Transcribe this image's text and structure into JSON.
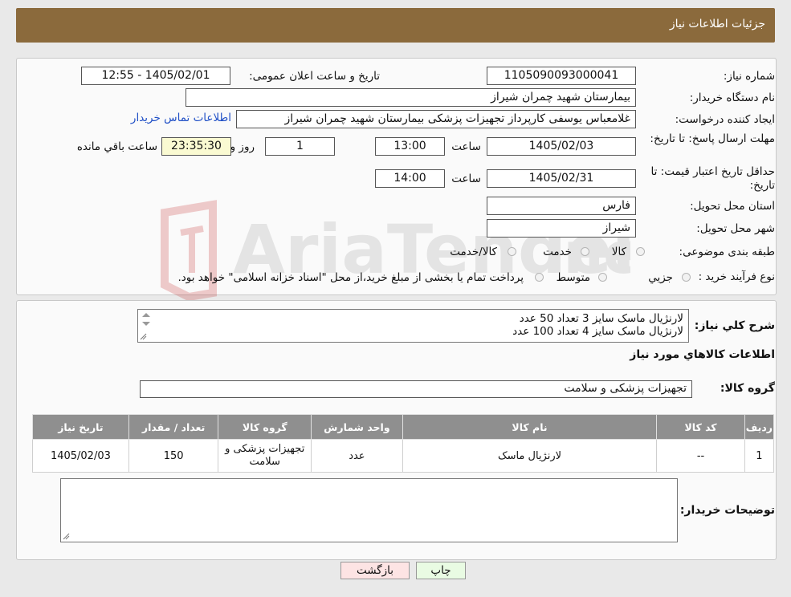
{
  "header": {
    "title": "جزئیات اطلاعات نیاز"
  },
  "fields": {
    "need_number_label": "شماره نیاز:",
    "need_number": "1105090093000041",
    "announce_label": "تاریخ و ساعت اعلان عمومی:",
    "announce_value": "1405/02/01 - 12:55",
    "buyer_org_label": "نام دستگاه خریدار:",
    "buyer_org": "بیمارستان شهید چمران شیراز",
    "requester_label": "ایجاد کننده درخواست:",
    "requester": "غلامعباس  یوسفی کارپرداز تجهیزات پزشکی بیمارستان شهید چمران شیراز",
    "contact_link": "اطلاعات تماس خریدار",
    "deadline_label": "مهلت ارسال پاسخ: تا تاریخ:",
    "deadline_date": "1405/02/03",
    "time_label": "ساعت",
    "deadline_time": "13:00",
    "days_value": "1",
    "days_label": "روز و",
    "remaining_value": "23:35:30",
    "remaining_label": "ساعت باقي مانده",
    "validity_label": "حداقل تاریخ اعتبار قیمت: تا تاریخ:",
    "validity_date": "1405/02/31",
    "validity_time_label": "ساعت",
    "validity_time": "14:00",
    "province_label": "استان محل تحویل:",
    "province": "فارس",
    "city_label": "شهر محل تحویل:",
    "city": "شیراز",
    "category_label": "طبقه بندی موضوعی:",
    "category_options": [
      "کالا",
      "خدمت",
      "کالا/خدمت"
    ],
    "process_label": "نوع فرآیند خرید :",
    "process_options": [
      "جزیي",
      "متوسط"
    ],
    "process_note": "پرداخت تمام یا بخشی از مبلغ خرید،از محل \"اسناد خزانه اسلامی\" خواهد بود."
  },
  "description": {
    "label": "شرح کلي نیاز:",
    "lines": [
      "لارنژیال ماسک سایز 3  تعداد 50 عدد",
      "لارنژیال ماسک سایز 4 تعداد 100 عدد"
    ]
  },
  "goods": {
    "section_title": "اطلاعات کالاهاي مورد نیاز",
    "group_label": "گروه کالا:",
    "group_value": "تجهیزات پزشکی و سلامت",
    "columns": [
      "ردیف",
      "کد کالا",
      "نام کالا",
      "واحد شمارش",
      "گروه کالا",
      "تعداد / مقدار",
      "تاریخ نیاز"
    ],
    "rows": [
      [
        "1",
        "--",
        "لارنژیال ماسک",
        "عدد",
        "تجهیزات پزشکی و سلامت",
        "150",
        "1405/02/03"
      ]
    ]
  },
  "buyer_notes": {
    "label": "توضیحات خریدار:",
    "value": ""
  },
  "buttons": {
    "print": "چاپ",
    "back": "بازگشت"
  },
  "colors": {
    "header": "#8b6a3c",
    "link": "#1f4fc6",
    "back_button": "#fde4e4",
    "print_button": "#e9fbe3"
  }
}
